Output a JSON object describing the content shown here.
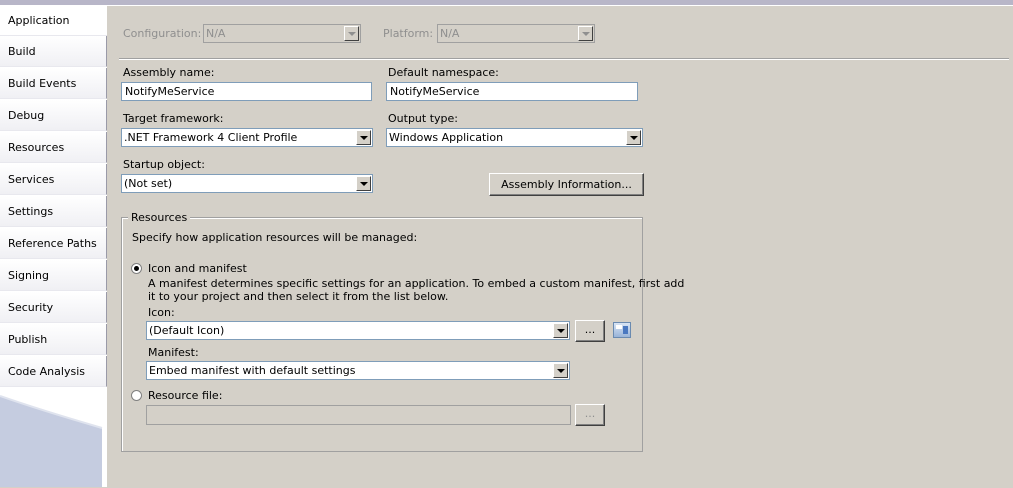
{
  "nav": {
    "items": [
      {
        "label": "Application"
      },
      {
        "label": "Build"
      },
      {
        "label": "Build Events"
      },
      {
        "label": "Debug"
      },
      {
        "label": "Resources"
      },
      {
        "label": "Services"
      },
      {
        "label": "Settings"
      },
      {
        "label": "Reference Paths"
      },
      {
        "label": "Signing"
      },
      {
        "label": "Security"
      },
      {
        "label": "Publish"
      },
      {
        "label": "Code Analysis"
      }
    ],
    "active": "Application"
  },
  "config": {
    "configuration_label": "Configuration:",
    "configuration_value": "N/A",
    "platform_label": "Platform:",
    "platform_value": "N/A"
  },
  "form": {
    "assembly_name_label": "Assembly name:",
    "assembly_name_value": "NotifyMeService",
    "default_namespace_label": "Default namespace:",
    "default_namespace_value": "NotifyMeService",
    "target_framework_label": "Target framework:",
    "target_framework_value": ".NET Framework 4 Client Profile",
    "output_type_label": "Output type:",
    "output_type_value": "Windows Application",
    "startup_object_label": "Startup object:",
    "startup_object_value": "(Not set)",
    "assembly_info_button": "Assembly Information..."
  },
  "resources": {
    "group_title": "Resources",
    "description": "Specify how application resources will be managed:",
    "icon_manifest_label": "Icon and manifest",
    "icon_manifest_selected": true,
    "icon_manifest_desc_line1": "A manifest determines specific settings for an application. To embed a custom manifest, first add",
    "icon_manifest_desc_line2": "it to your project and then select it from the list below.",
    "icon_label": "Icon:",
    "icon_value": "(Default Icon)",
    "browse_label": "...",
    "manifest_label": "Manifest:",
    "manifest_value": "Embed manifest with default settings",
    "resource_file_label": "Resource file:",
    "resource_file_selected": false,
    "resource_file_value": "",
    "resource_browse_label": "..."
  },
  "colors": {
    "background": "#d4d0c8",
    "sidebar": "#ffffff",
    "field_border": "#7f9db9"
  }
}
